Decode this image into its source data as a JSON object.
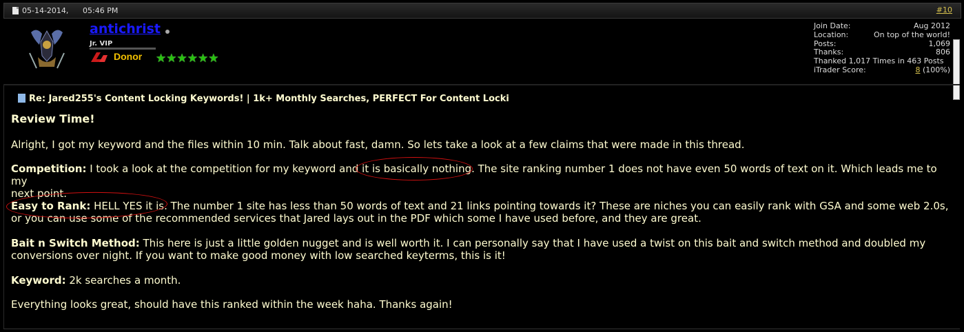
{
  "post_header": {
    "date": "05-14-2014,",
    "time": "05:46 PM",
    "post_number": "#10"
  },
  "user": {
    "username": "antichrist",
    "title": "Jr. VIP",
    "donor_label": "Donor",
    "stars": "★★★★★★",
    "stats": [
      {
        "label": "Join Date:",
        "value": "Aug 2012"
      },
      {
        "label": "Location:",
        "value": "On top of the world!"
      },
      {
        "label": "Posts:",
        "value": "1,069"
      },
      {
        "label": "Thanks:",
        "value": "806"
      },
      {
        "label": "Thanked 1,017 Times in 463 Posts",
        "value": ""
      },
      {
        "label": "iTrader Score:",
        "value_link": "8",
        "value_suffix": " (100%)"
      }
    ]
  },
  "post": {
    "title": "Re: Jared255's Content Locking Keywords! | 1k+ Monthly Searches, PERFECT For Content Locki",
    "heading": "Review Time!",
    "p1": "Alright, I got my keyword and the files within 10 min. Talk about fast, damn. So lets take a look at a few claims that were made in this thread.",
    "competition_label": "Competition:",
    "competition_text": " I took a look at the competition for my keyword and it is basically nothing. The site ranking number 1 does not have even 50 words of text on it. Which leads me to my",
    "competition_text_2": "next point.",
    "easy_label": "Easy to Rank:",
    "easy_text": " HELL YES it is. The number 1 site has less than 50 words of text and 21 links pointing towards it? These are niches you can easily rank with GSA and some web 2.0s,",
    "easy_text_2": "or you can use some of the recommended services that Jared lays out in the PDF which some I have used before, and they are great.",
    "bait_label": "Bait n Switch Method:",
    "bait_text": " This here is just a little golden nugget and is well worth it. I can personally say that I have used a twist on this bait and switch method and doubled my",
    "bait_text_2": "conversions over night. If you want to make good money with low searched keyterms, this is it!",
    "keyword_label": "Keyword:",
    "keyword_text": " 2k searches a month.",
    "closing": "Everything looks great, should have this ranked within the week haha. Thanks again!"
  },
  "colors": {
    "background": "#000000",
    "text": "#fffcd0",
    "username": "#1a1aff",
    "donor": "#f2c000",
    "stars": "#29c010",
    "annotation": "#d21010"
  }
}
